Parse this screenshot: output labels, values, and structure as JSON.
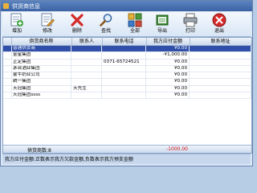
{
  "window": {
    "title": "供货商信息"
  },
  "toolbar": {
    "buttons": [
      {
        "label": "增加",
        "icon": "add-icon"
      },
      {
        "label": "修改",
        "icon": "edit-icon"
      },
      {
        "label": "删除",
        "icon": "delete-icon"
      },
      {
        "label": "查找",
        "icon": "search-icon"
      },
      {
        "label": "全部",
        "icon": "all-icon"
      },
      {
        "label": "导出",
        "icon": "export-icon"
      },
      {
        "label": "打印",
        "icon": "print-icon"
      },
      {
        "label": "退出",
        "icon": "exit-icon"
      }
    ]
  },
  "table": {
    "columns": [
      "供货商名称",
      "联系人",
      "联系电话",
      "我方应付金额",
      "联系地址"
    ],
    "rows": [
      [
        "普通供货商",
        "",
        "",
        "¥0.00",
        ""
      ],
      [
        "金星集团",
        "",
        "",
        "-¥1,000.00",
        ""
      ],
      [
        "正定集团",
        "",
        "0371-65724521",
        "¥0.00",
        ""
      ],
      [
        "茅台酒业集团",
        "",
        "",
        "¥0.00",
        ""
      ],
      [
        "蒙牛奶业公司",
        "",
        "",
        "¥0.00",
        ""
      ],
      [
        "统一集团",
        "",
        "",
        "¥0.00",
        ""
      ],
      [
        "天冠集团",
        "天先生",
        "",
        "¥0.00",
        ""
      ],
      [
        "天冠集团ssss",
        "",
        "",
        "¥0.00",
        ""
      ]
    ],
    "selected_row": 0
  },
  "footer": {
    "count_label": "供货商数:8",
    "total": "-1000.00"
  },
  "status": {
    "text": "我方应付金额:正数表示我方欠款金额,负数表示我方预支金额"
  },
  "colors": {
    "selected_row": "#2f4fa8",
    "negative_total": "#d21616"
  }
}
